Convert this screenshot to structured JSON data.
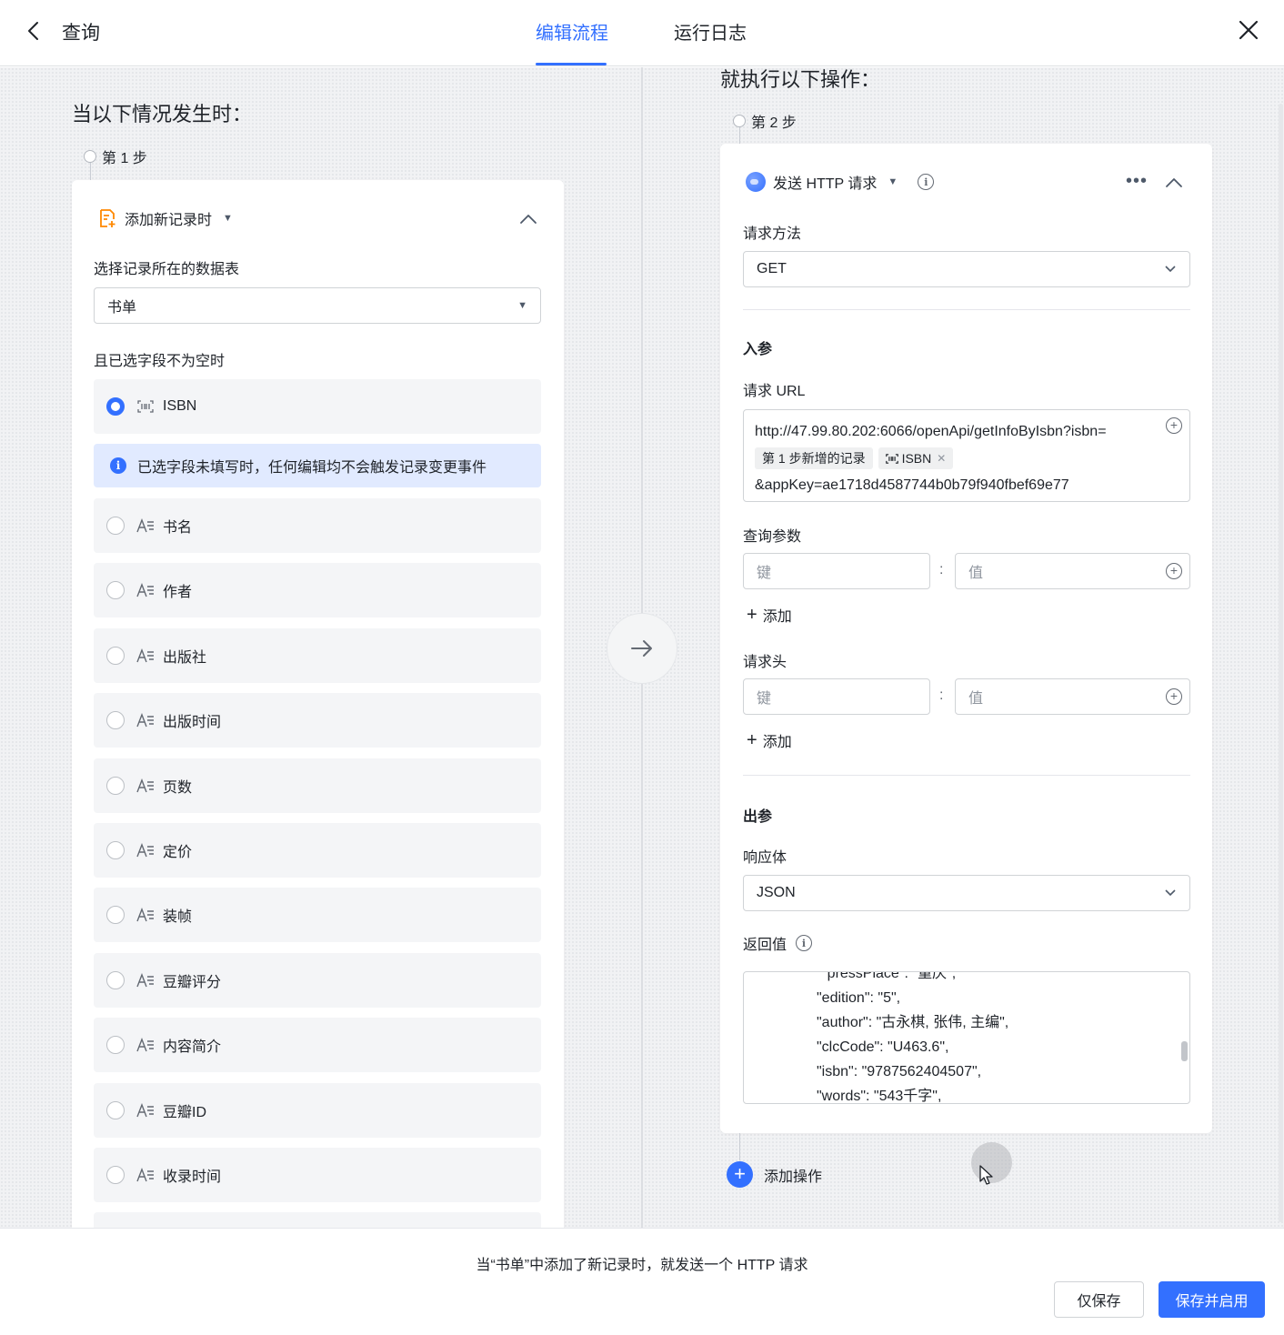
{
  "header": {
    "title": "查询",
    "tabs": [
      {
        "label": "编辑流程",
        "active": true
      },
      {
        "label": "运行日志",
        "active": false
      }
    ]
  },
  "left": {
    "section_title": "当以下情况发生时：",
    "step_label": "第 1 步",
    "trigger": {
      "label": "添加新记录时",
      "icon": "record-add-icon"
    },
    "table_label": "选择记录所在的数据表",
    "table_value": "书单",
    "condition_label": "且已选字段不为空时",
    "notice": "已选字段未填写时，任何编辑均不会触发记录变更事件",
    "selected_field": {
      "name": "ISBN",
      "icon": "barcode-icon"
    },
    "fields": [
      {
        "name": "书名"
      },
      {
        "name": "作者"
      },
      {
        "name": "出版社"
      },
      {
        "name": "出版时间"
      },
      {
        "name": "页数"
      },
      {
        "name": "定价"
      },
      {
        "name": "装帧"
      },
      {
        "name": "豆瓣评分"
      },
      {
        "name": "内容简介"
      },
      {
        "name": "豆瓣ID"
      },
      {
        "name": "收录时间"
      }
    ]
  },
  "right": {
    "section_title": "就执行以下操作：",
    "step_label": "第 2 步",
    "action": {
      "label": "发送 HTTP 请求",
      "icon": "globe-icon"
    },
    "method_label": "请求方法",
    "method_value": "GET",
    "input_title": "入参",
    "url_label": "请求 URL",
    "url_line1": "http://47.99.80.202:6066/openApi/getInfoByIsbn?isbn=",
    "url_chip_step": "第 1 步新增的记录",
    "url_chip_field": "ISBN",
    "url_line3": "&appKey=ae1718d4587744b0b79f940fbef69e77",
    "query_label": "查询参数",
    "key_placeholder": "键",
    "value_placeholder": "值",
    "add_label": "添加",
    "headers_label": "请求头",
    "output_title": "出参",
    "response_label": "响应体",
    "response_value": "JSON",
    "return_label": "返回值",
    "json_lines": [
      "\"pressPlace\": \"重庆\",",
      "\"edition\": \"5\",",
      "\"author\": \"古永棋, 张伟, 主编\",",
      "\"clcCode\": \"U463.6\",",
      "\"isbn\": \"9787562404507\",",
      "\"words\": \"543千字\","
    ],
    "add_action_label": "添加操作"
  },
  "footer": {
    "summary": "当“书单”中添加了新记录时，就发送一个 HTTP 请求",
    "save_only": "仅保存",
    "save_enable": "保存并启用"
  },
  "colors": {
    "accent": "#3370ff",
    "notice_bg": "#e1eaff",
    "canvas_bg": "#f1f2f4"
  }
}
